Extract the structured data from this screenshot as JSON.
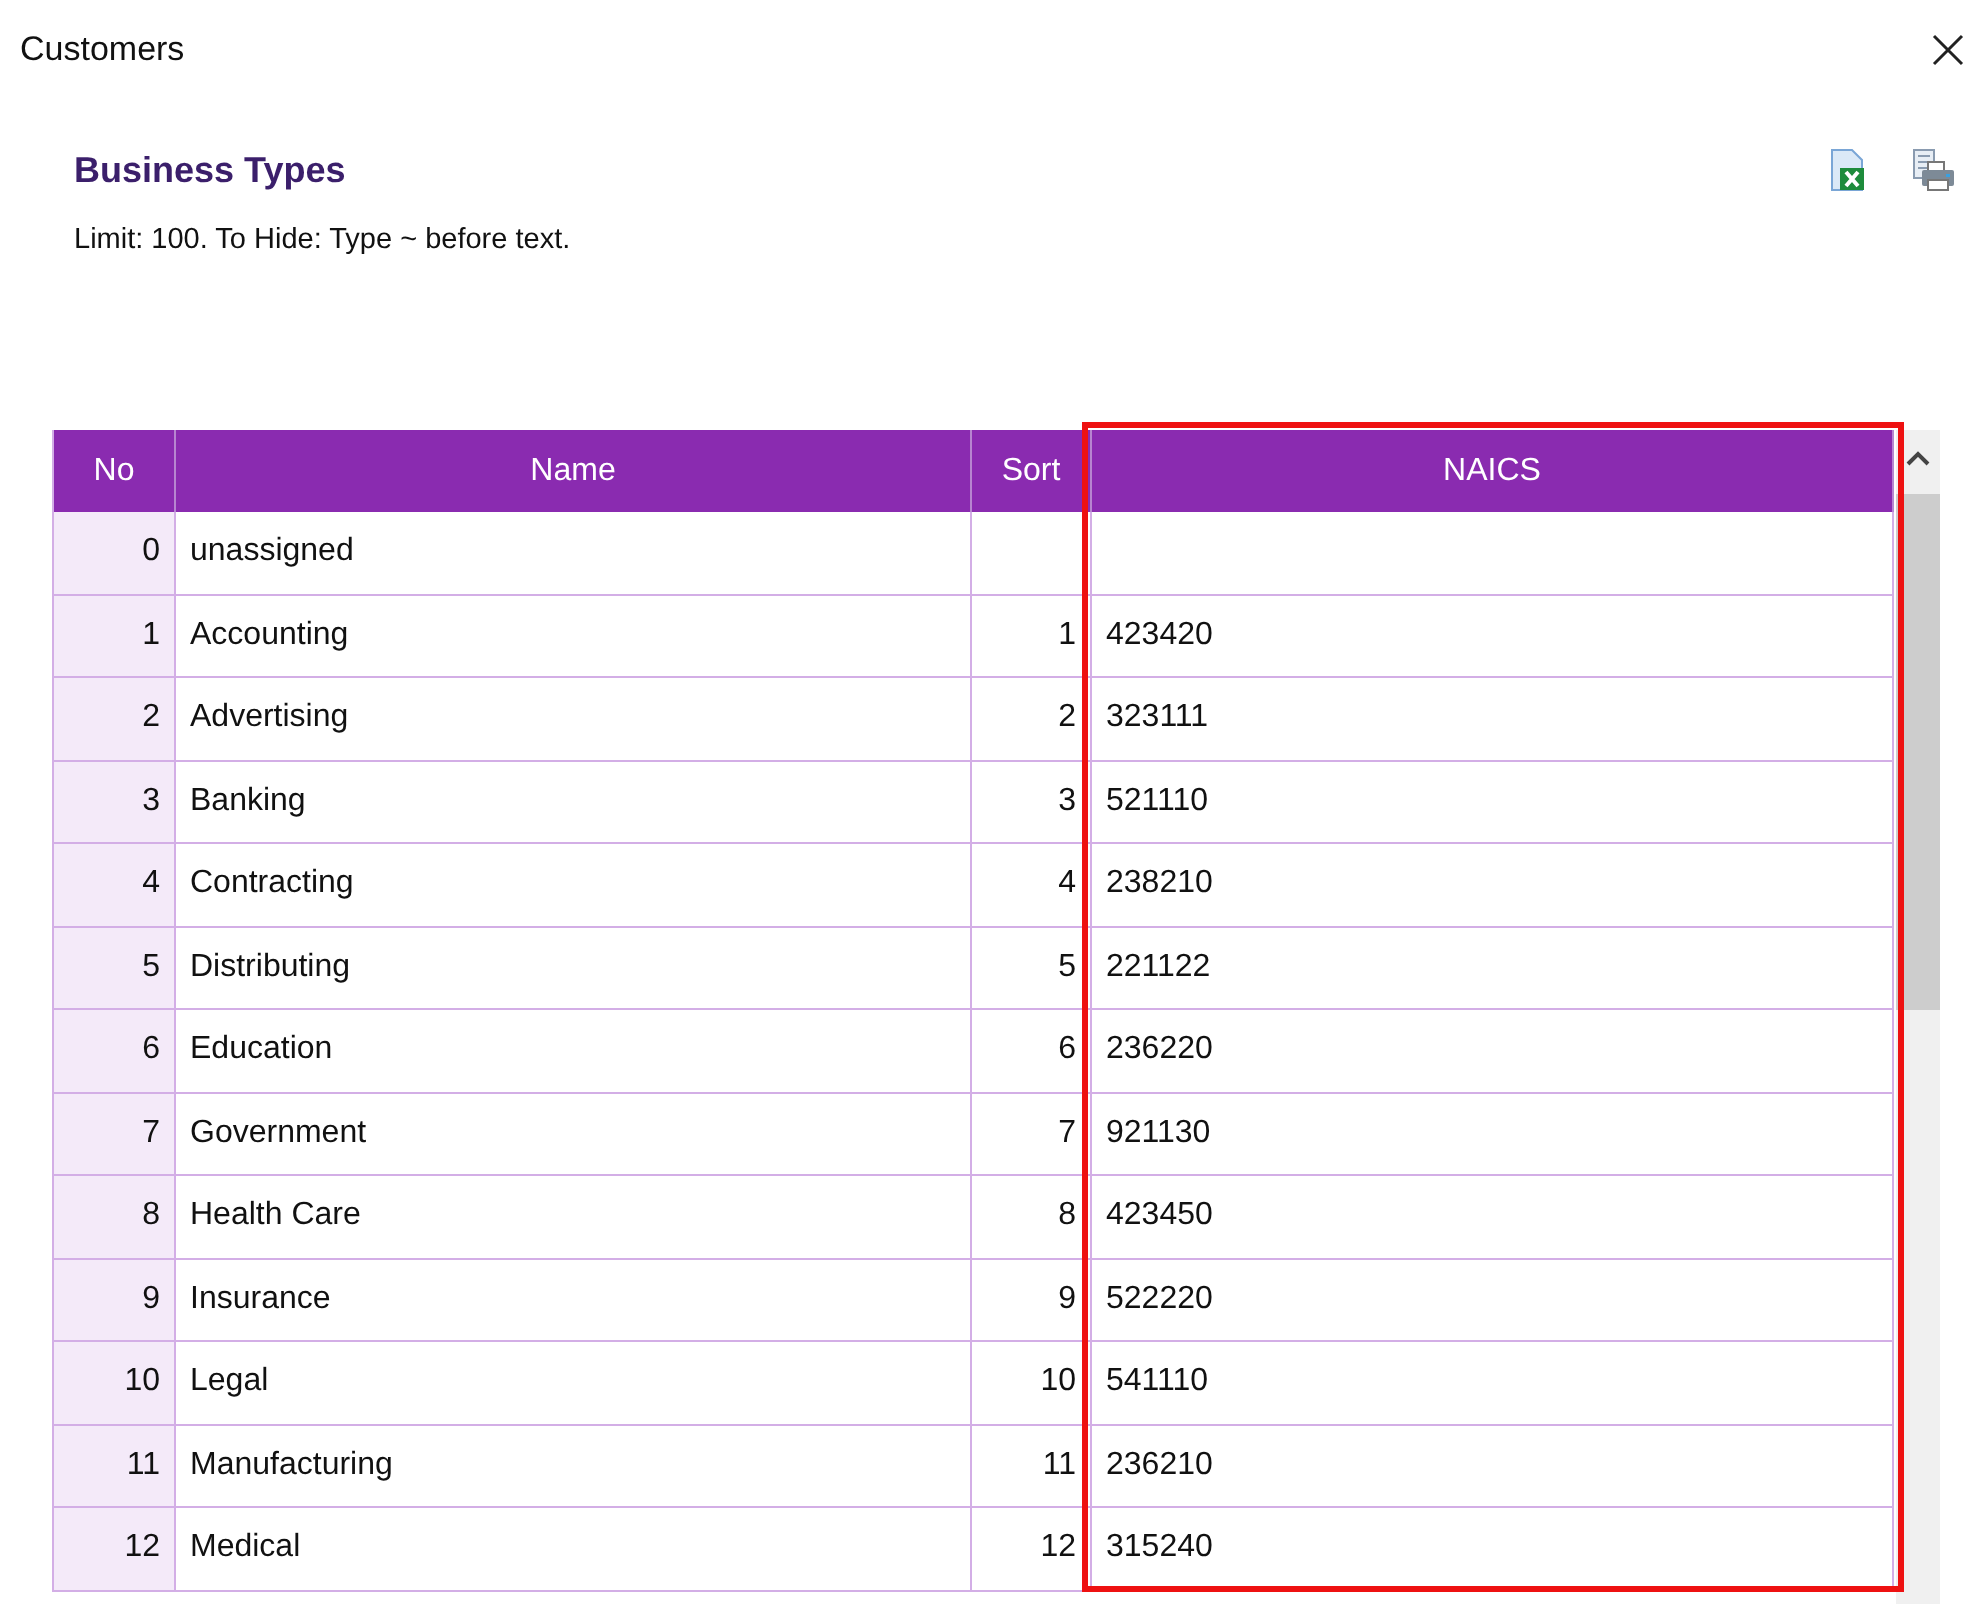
{
  "window": {
    "title": "Customers"
  },
  "heading": "Business Types",
  "hint": "Limit: 100. To Hide: Type ~ before text.",
  "table": {
    "columns": [
      {
        "label": "No",
        "highlighted": false
      },
      {
        "label": "Name",
        "highlighted": false
      },
      {
        "label": "Sort",
        "highlighted": false
      },
      {
        "label": "NAICS",
        "highlighted": true
      }
    ],
    "rows": [
      [
        "0",
        "unassigned",
        "",
        ""
      ],
      [
        "1",
        "Accounting",
        "1",
        "423420"
      ],
      [
        "2",
        "Advertising",
        "2",
        "323111"
      ],
      [
        "3",
        "Banking",
        "3",
        "521110"
      ],
      [
        "4",
        "Contracting",
        "4",
        "238210"
      ],
      [
        "5",
        "Distributing",
        "5",
        "221122"
      ],
      [
        "6",
        "Education",
        "6",
        "236220"
      ],
      [
        "7",
        "Government",
        "7",
        "921130"
      ],
      [
        "8",
        "Health Care",
        "8",
        "423450"
      ],
      [
        "9",
        "Insurance",
        "9",
        "522220"
      ],
      [
        "10",
        "Legal",
        "10",
        "541110"
      ],
      [
        "11",
        "Manufacturing",
        "11",
        "236210"
      ],
      [
        "12",
        "Medical",
        "12",
        "315240"
      ]
    ]
  }
}
